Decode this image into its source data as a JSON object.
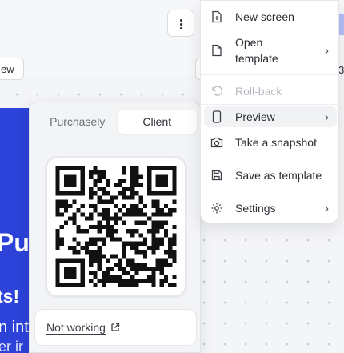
{
  "background": {
    "left_button_label": "ew",
    "right_edge_char": "3"
  },
  "preview": {
    "line1": "Pu",
    "line2": "ts!",
    "line3": "n int",
    "line4": "er ir"
  },
  "qr_popover": {
    "tabs": [
      {
        "label": "Purchasely",
        "active": false
      },
      {
        "label": "Client",
        "active": true
      }
    ],
    "not_working_label": "Not working"
  },
  "menu": {
    "items": [
      {
        "label": "New screen",
        "icon": "new-screen-icon",
        "has_submenu": false,
        "disabled": false
      },
      {
        "label": "Open\ntemplate",
        "icon": "open-template-icon",
        "has_submenu": true,
        "disabled": false
      },
      {
        "label": "Roll-back",
        "icon": "rollback-icon",
        "has_submenu": false,
        "disabled": true
      },
      {
        "label": "Preview",
        "icon": "preview-phone-icon",
        "has_submenu": true,
        "disabled": false,
        "highlighted": true
      },
      {
        "label": "Take a snapshot",
        "icon": "camera-icon",
        "has_submenu": false,
        "disabled": false
      },
      {
        "label": "Save as template",
        "icon": "save-icon",
        "has_submenu": false,
        "disabled": false
      },
      {
        "label": "Settings",
        "icon": "gear-icon",
        "has_submenu": true,
        "disabled": false
      }
    ],
    "chevron": "›"
  },
  "colors": {
    "preview_blue": "#2c42d9",
    "menu_text": "#2a2d33",
    "disabled_text": "#b7bac0"
  }
}
